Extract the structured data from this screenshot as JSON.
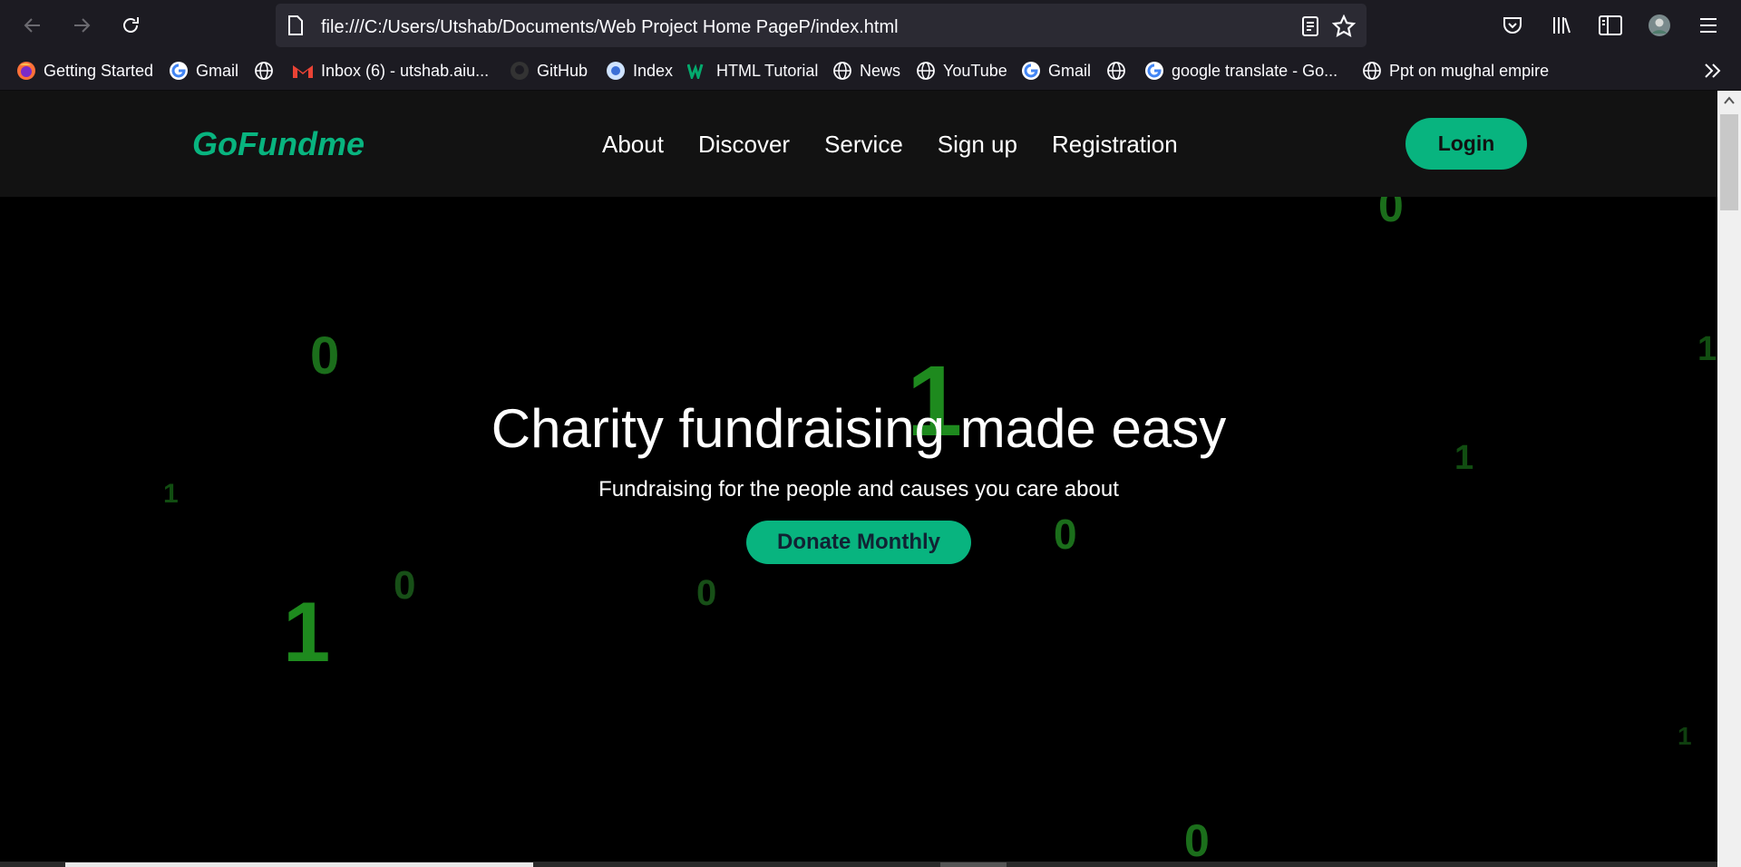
{
  "browser": {
    "url": "file:///C:/Users/Utshab/Documents/Web Project Home PageP/index.html",
    "bookmarks": [
      {
        "label": "Getting Started",
        "icon": "firefox-icon"
      },
      {
        "label": "Gmail",
        "icon": "google-icon"
      },
      {
        "label": "",
        "icon": "globe-icon"
      },
      {
        "label": "Inbox (6) - utshab.aiu...",
        "icon": "gmail-icon"
      },
      {
        "label": "GitHub",
        "icon": "github-icon"
      },
      {
        "label": "Index",
        "icon": "index-icon"
      },
      {
        "label": "HTML Tutorial",
        "icon": "w3schools-icon"
      },
      {
        "label": "News",
        "icon": "globe-icon"
      },
      {
        "label": "YouTube",
        "icon": "globe-icon"
      },
      {
        "label": "Gmail",
        "icon": "google-icon"
      },
      {
        "label": "",
        "icon": "globe-icon"
      },
      {
        "label": "google translate - Go...",
        "icon": "google-icon"
      },
      {
        "label": "Ppt on mughal empire",
        "icon": "globe-icon"
      }
    ]
  },
  "site": {
    "logo": "GoFundme",
    "nav": [
      "About",
      "Discover",
      "Service",
      "Sign up",
      "Registration"
    ],
    "login_label": "Login",
    "hero_title": "Charity fundraising made easy",
    "hero_subtitle": "Fundraising for the people and causes you care about",
    "donate_label": "Donate Monthly",
    "background_digits": [
      "0",
      "0",
      "1",
      "1",
      "1",
      "0",
      "0",
      "1",
      "0",
      "1",
      "1",
      "0"
    ]
  },
  "colors": {
    "brand_green": "#08b47f",
    "digit_green": "#1e8a1e",
    "header_bg": "#121212",
    "chrome_bg": "#1c1b22"
  }
}
